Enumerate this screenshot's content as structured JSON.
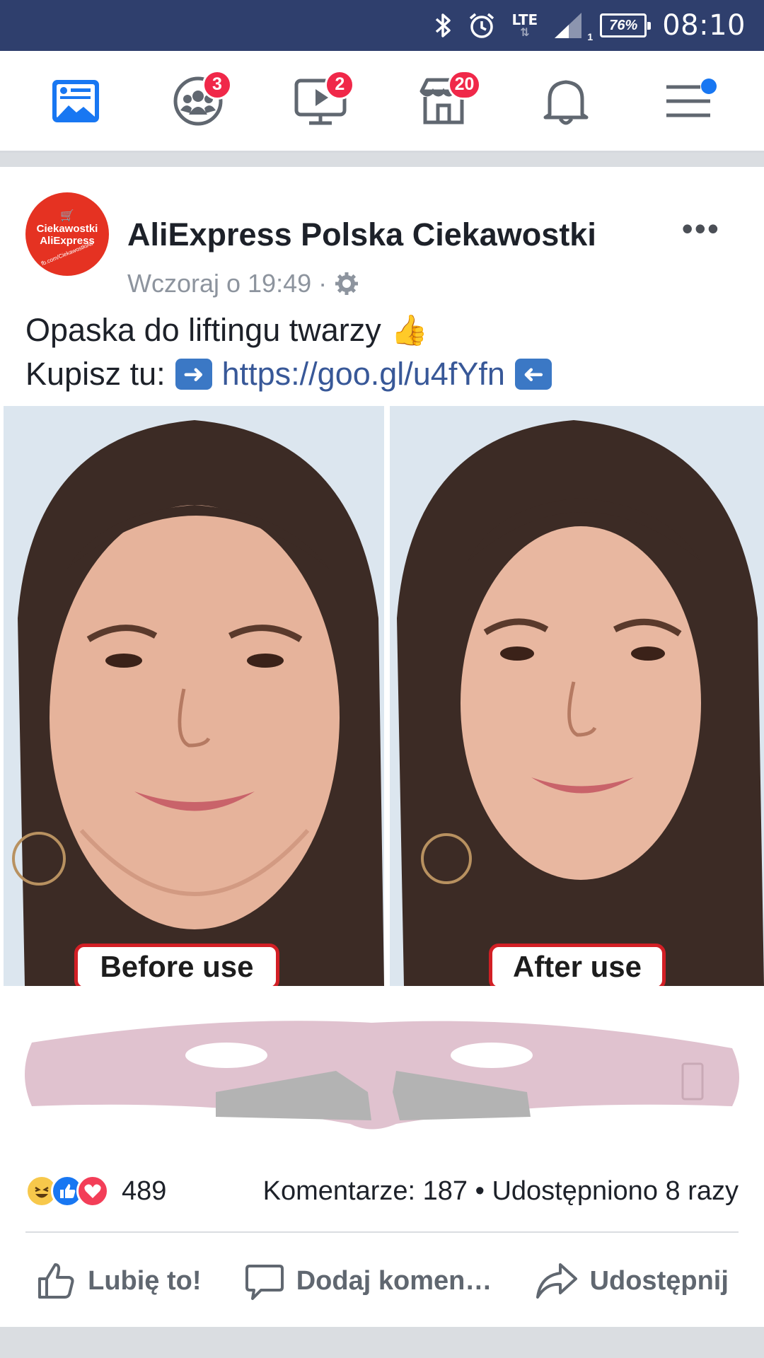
{
  "status_bar": {
    "network": "LTE",
    "signal_sub": "1",
    "battery": "76%",
    "time": "08:10"
  },
  "nav": {
    "items": [
      {
        "name": "news-feed",
        "badge": ""
      },
      {
        "name": "groups",
        "badge": "3"
      },
      {
        "name": "watch",
        "badge": "2"
      },
      {
        "name": "marketplace",
        "badge": "20"
      },
      {
        "name": "notifications",
        "badge": ""
      },
      {
        "name": "menu",
        "badge": ""
      }
    ],
    "active_color": "#1877f2",
    "badge_color": "#f02849"
  },
  "post": {
    "avatar": {
      "line1": "Ciekawostki",
      "line2": "AliExpress",
      "line3": "fb.com/CiekawostkiAli"
    },
    "page_name": "AliExpress Polska Ciekawostki",
    "timestamp": "Wczoraj o 19:49 ·",
    "text_line1": "Opaska do liftingu twarzy",
    "text_line2_prefix": "Kupisz tu:",
    "link": "https://goo.gl/u4fYfn",
    "image": {
      "before_label": "Before use",
      "after_label": "After use"
    },
    "reactions_count": "489",
    "comments_shares": "Komentarze: 187 • Udostępniono 8 razy",
    "actions": {
      "like": "Lubię to!",
      "comment": "Dodaj komen…",
      "share": "Udostępnij"
    }
  }
}
